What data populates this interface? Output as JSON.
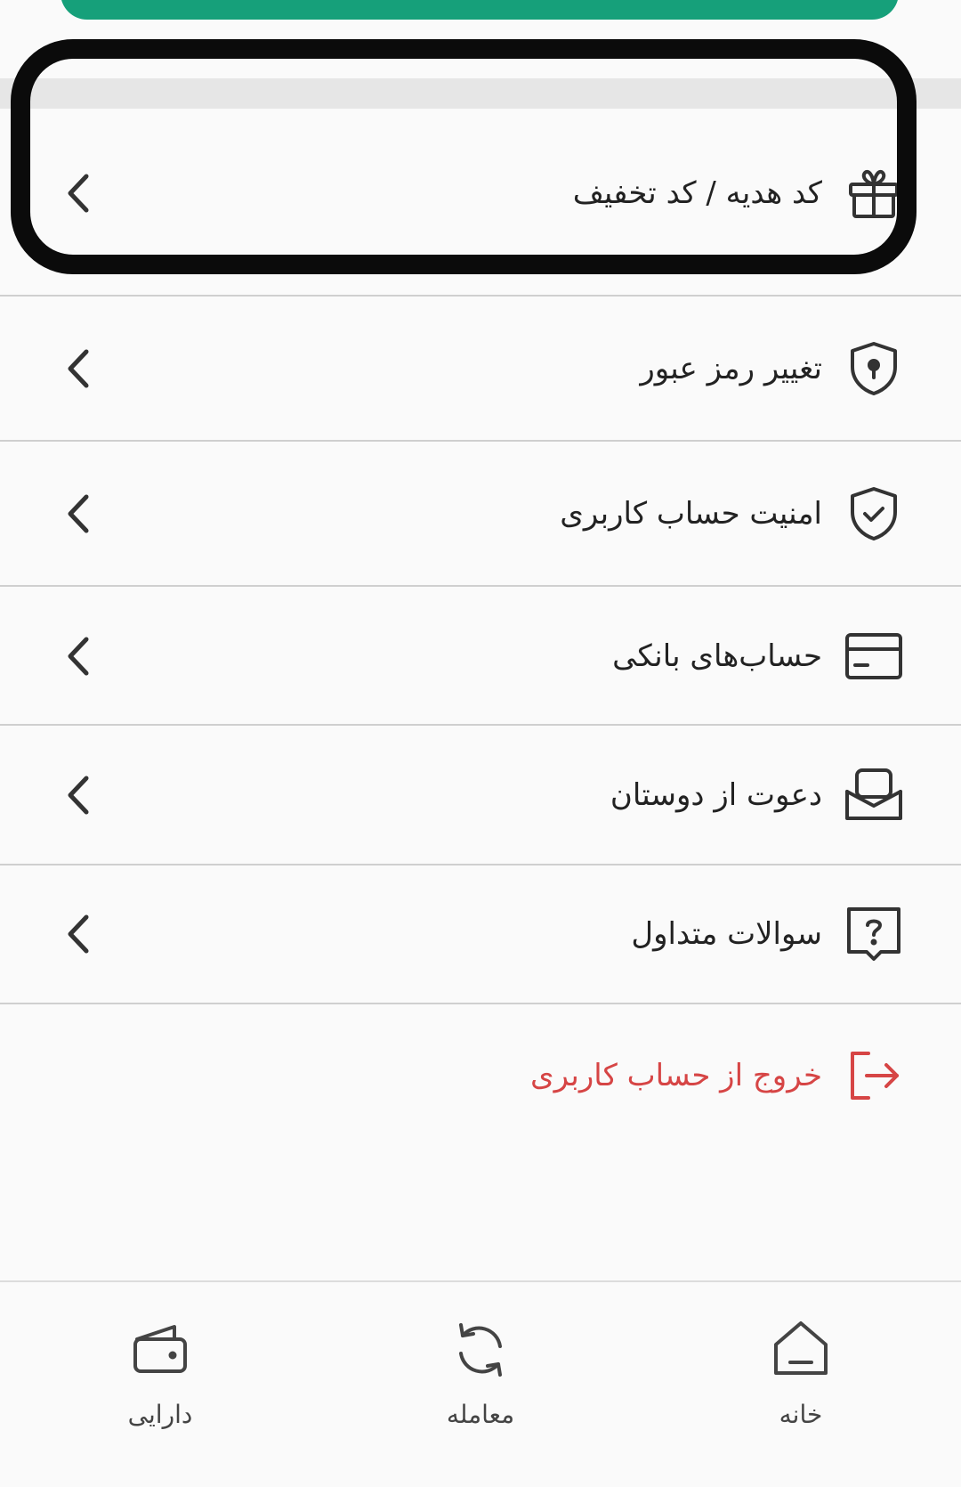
{
  "menu": {
    "items": [
      {
        "label": "کد هدیه / کد تخفیف",
        "icon": "gift-icon"
      },
      {
        "label": "تغییر رمز عبور",
        "icon": "keyhole-shield-icon"
      },
      {
        "label": "امنیت حساب کاربری",
        "icon": "check-shield-icon"
      },
      {
        "label": "حساب‌های بانکی",
        "icon": "bank-card-icon"
      },
      {
        "label": "دعوت از دوستان",
        "icon": "envelope-icon"
      },
      {
        "label": "سوالات متداول",
        "icon": "question-message-icon"
      }
    ],
    "logout_label": "خروج از حساب کاربری"
  },
  "nav": {
    "items": [
      {
        "label": "دارایی",
        "icon": "wallet-icon"
      },
      {
        "label": "معامله",
        "icon": "refresh-icon"
      },
      {
        "label": "خانه",
        "icon": "home-icon"
      }
    ]
  },
  "colors": {
    "accent": "#16a07a",
    "danger": "#d64545",
    "text": "#222222",
    "divider": "#cfcfcf",
    "highlight": "#0b0b0b"
  }
}
